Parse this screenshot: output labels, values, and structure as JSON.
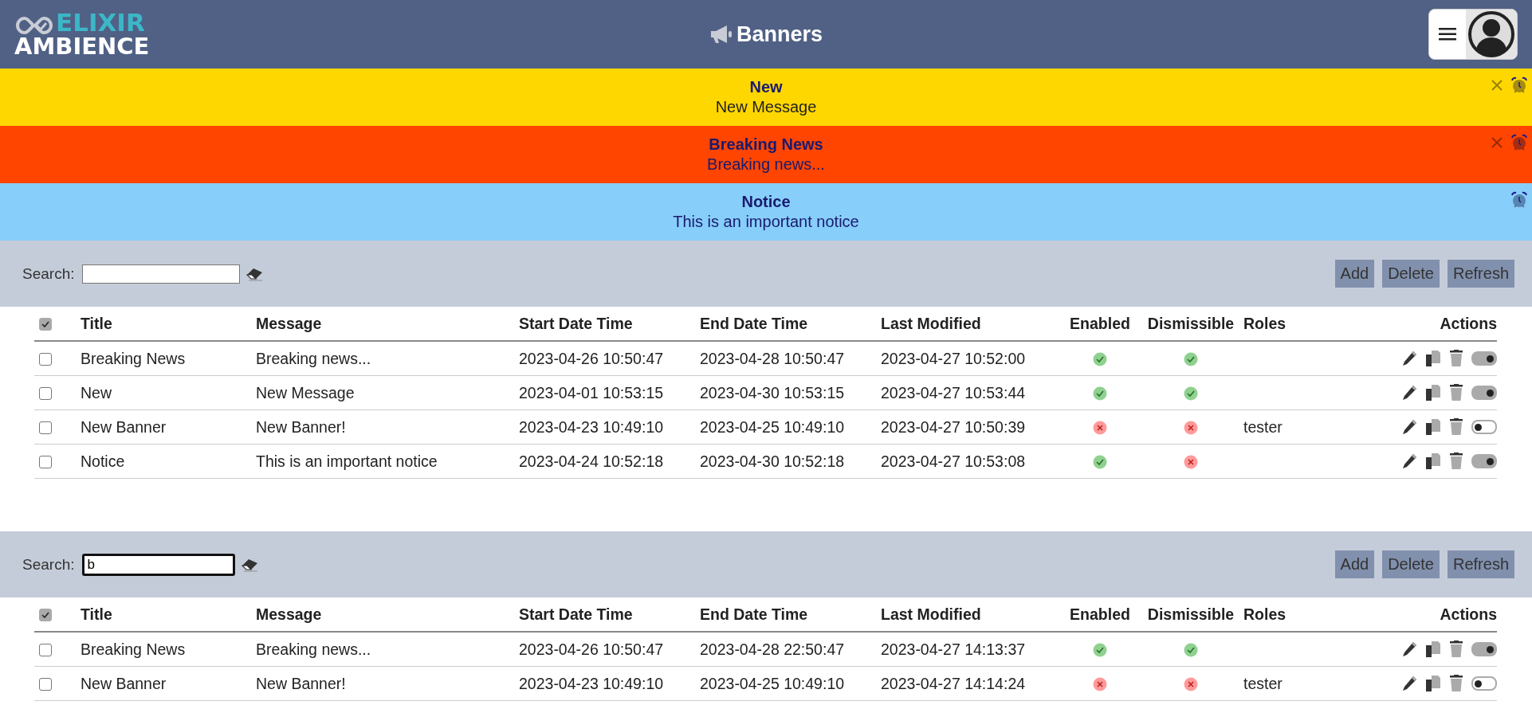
{
  "header": {
    "logo": {
      "top": "ELIXIR",
      "bottom": "AMBIENCE"
    },
    "title": "Banners"
  },
  "banners": [
    {
      "title": "New",
      "message": "New Message",
      "color": "#ffd700",
      "dismissible": true
    },
    {
      "title": "Breaking News",
      "message": "Breaking news...",
      "color": "#ff4500",
      "dismissible": true
    },
    {
      "title": "Notice",
      "message": "This is an important notice",
      "color": "#87cefa",
      "dismissible": false
    }
  ],
  "grids": [
    {
      "search": {
        "label": "Search:",
        "focused": false
      },
      "buttons": [
        "Add",
        "Delete",
        "Refresh"
      ],
      "select_all": {
        "checked": true
      },
      "columns": [
        "Title",
        "Message",
        "Start Date Time",
        "End Date Time",
        "Last Modified",
        "Enabled",
        "Dismissible",
        "Roles",
        "Actions"
      ],
      "rows": [
        {
          "checked": false,
          "title": "Breaking News",
          "message": "Breaking news...",
          "start": "2023-04-26 10:50:47",
          "end": "2023-04-28 10:50:47",
          "modified": "2023-04-27 10:52:00",
          "enabled": true,
          "dismissible": true
        },
        {
          "checked": false,
          "title": "New",
          "message": "New Message",
          "start": "2023-04-01 10:53:15",
          "end": "2023-04-30 10:53:15",
          "modified": "2023-04-27 10:53:44",
          "enabled": true,
          "dismissible": true
        },
        {
          "checked": false,
          "title": "New Banner",
          "message": "New Banner!",
          "start": "2023-04-23 10:49:10",
          "end": "2023-04-25 10:49:10",
          "modified": "2023-04-27 10:50:39",
          "enabled": false,
          "dismissible": false,
          "roles": "tester"
        },
        {
          "checked": false,
          "title": "Notice",
          "message": "This is an important notice",
          "start": "2023-04-24 10:52:18",
          "end": "2023-04-30 10:52:18",
          "modified": "2023-04-27 10:53:08",
          "enabled": true,
          "dismissible": false
        }
      ]
    },
    {
      "search": {
        "label": "Search:",
        "value": "b",
        "focused": true
      },
      "buttons": [
        "Add",
        "Delete",
        "Refresh"
      ],
      "select_all": {
        "checked": true
      },
      "columns": [
        "Title",
        "Message",
        "Start Date Time",
        "End Date Time",
        "Last Modified",
        "Enabled",
        "Dismissible",
        "Roles",
        "Actions"
      ],
      "rows": [
        {
          "checked": false,
          "title": "Breaking News",
          "message": "Breaking news...",
          "start": "2023-04-26 10:50:47",
          "end": "2023-04-28 22:50:47",
          "modified": "2023-04-27 14:13:37",
          "enabled": true,
          "dismissible": true
        },
        {
          "checked": false,
          "title": "New Banner",
          "message": "New Banner!",
          "start": "2023-04-23 10:49:10",
          "end": "2023-04-25 10:49:10",
          "modified": "2023-04-27 14:14:24",
          "enabled": false,
          "dismissible": false,
          "roles": "tester"
        }
      ]
    }
  ]
}
